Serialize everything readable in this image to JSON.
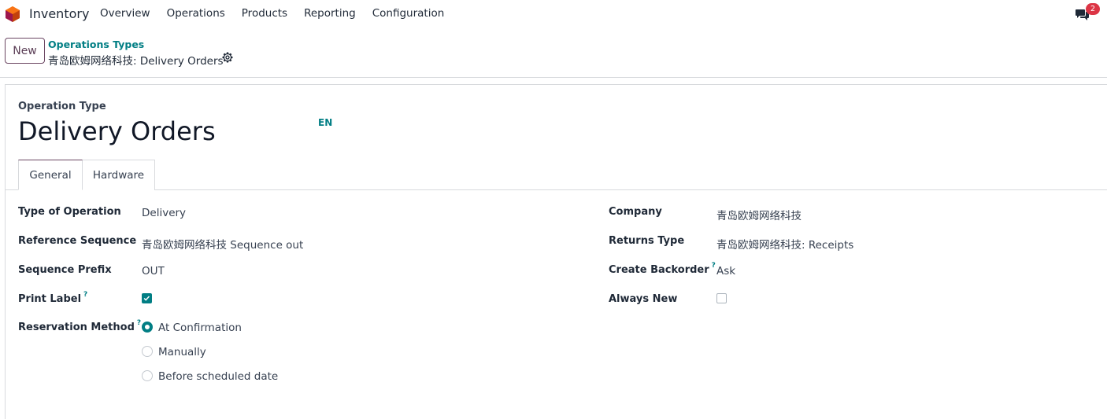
{
  "navbar": {
    "app_name": "Inventory",
    "logo_icon": "inventory-app-logo",
    "menu": [
      "Overview",
      "Operations",
      "Products",
      "Reporting",
      "Configuration"
    ],
    "chat_icon": "chat-bubbles-icon",
    "notification_count": "2"
  },
  "control_panel": {
    "new_label": "New",
    "breadcrumb_parent": "Operations Types",
    "breadcrumb_current": "青岛欧姆网络科技: Delivery Orders",
    "gear_icon": "gear-icon"
  },
  "form": {
    "section_label": "Operation Type",
    "title": "Delivery Orders",
    "lang": "EN",
    "tabs": [
      "General",
      "Hardware"
    ],
    "active_tab": "General",
    "left_fields": {
      "type_of_operation": {
        "label": "Type of Operation",
        "value": "Delivery"
      },
      "reference_sequence": {
        "label": "Reference Sequence",
        "value": "青岛欧姆网络科技 Sequence out"
      },
      "sequence_prefix": {
        "label": "Sequence Prefix",
        "value": "OUT"
      },
      "print_label": {
        "label": "Print Label",
        "help": "?",
        "checked": true
      },
      "reservation_method": {
        "label": "Reservation Method",
        "help": "?",
        "options": [
          "At Confirmation",
          "Manually",
          "Before scheduled date"
        ],
        "selected": "At Confirmation"
      }
    },
    "right_fields": {
      "company": {
        "label": "Company",
        "value": "青岛欧姆网络科技"
      },
      "returns_type": {
        "label": "Returns Type",
        "value": "青岛欧姆网络科技: Receipts"
      },
      "create_backorder": {
        "label": "Create Backorder",
        "help": "?",
        "value": "Ask"
      },
      "always_new": {
        "label": "Always New",
        "checked": false
      }
    }
  },
  "colors": {
    "brand_primary": "#6b4662",
    "accent_teal": "#017e84",
    "badge_red": "#dc3545"
  }
}
